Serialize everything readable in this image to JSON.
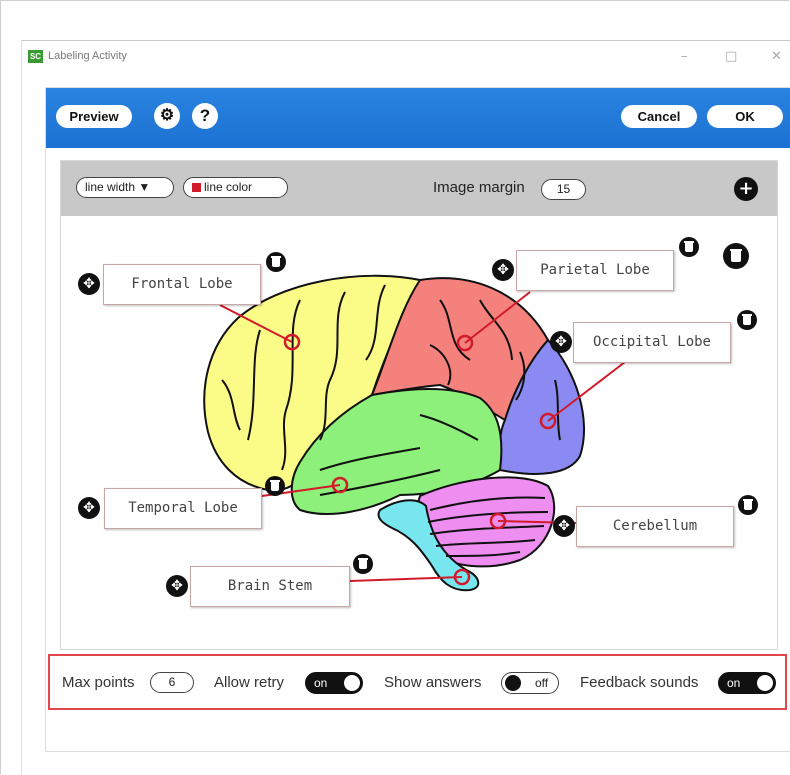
{
  "window": {
    "app_icon": "SC",
    "title": "Labeling Activity",
    "controls": {
      "minimize": "–",
      "maximize": "□",
      "close": "✕"
    }
  },
  "header": {
    "preview_label": "Preview",
    "settings_icon": "gear-icon",
    "help_label": "?",
    "cancel_label": "Cancel",
    "ok_label": "OK",
    "accent_color": "#1f77d8"
  },
  "toolbar": {
    "line_width_label": "line width ▼",
    "line_color_label": "line color",
    "line_color": "#d11a2a",
    "image_margin_label": "Image margin",
    "image_margin_value": "15",
    "add_label": "+"
  },
  "labels": [
    {
      "id": "frontal",
      "text": "Frontal Lobe"
    },
    {
      "id": "parietal",
      "text": "Parietal Lobe"
    },
    {
      "id": "occipital",
      "text": "Occipital Lobe"
    },
    {
      "id": "temporal",
      "text": "Temporal Lobe"
    },
    {
      "id": "cerebellum",
      "text": "Cerebellum"
    },
    {
      "id": "brainstem",
      "text": "Brain Stem"
    }
  ],
  "brain_colors": {
    "frontal": "#fbfb88",
    "parietal": "#f5817d",
    "occipital": "#8a8af2",
    "temporal": "#8df07a",
    "cerebellum": "#ee8ef0",
    "brainstem": "#78e6ef"
  },
  "settings": {
    "max_points_label": "Max points",
    "max_points_value": "6",
    "allow_retry_label": "Allow retry",
    "allow_retry_state": "on",
    "show_answers_label": "Show answers",
    "show_answers_state": "off",
    "feedback_sounds_label": "Feedback sounds",
    "feedback_sounds_state": "on",
    "highlight_color": "#e0464c"
  }
}
